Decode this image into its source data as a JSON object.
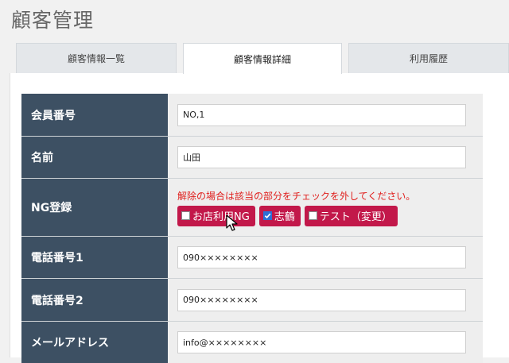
{
  "page": {
    "title": "顧客管理"
  },
  "tabs": [
    {
      "label": "顧客情報一覧",
      "active": false
    },
    {
      "label": "顧客情報詳細",
      "active": true
    },
    {
      "label": "利用履歴",
      "active": false
    }
  ],
  "form": {
    "member_no": {
      "label": "会員番号",
      "value": "NO,1"
    },
    "name": {
      "label": "名前",
      "value": "山田"
    },
    "ng": {
      "label": "NG登録",
      "note": "解除の場合は該当の部分をチェックを外してください。",
      "options": [
        {
          "label": "お店利用NG",
          "checked": false
        },
        {
          "label": "志鶴",
          "checked": true
        },
        {
          "label": "テスト（変更）",
          "checked": false
        }
      ]
    },
    "phone1": {
      "label": "電話番号1",
      "value": "090××××××××"
    },
    "phone2": {
      "label": "電話番号2",
      "value": "090××××××××"
    },
    "email": {
      "label": "メールアドレス",
      "value": "info@××××××××"
    }
  },
  "colors": {
    "header_bg": "#3d5063",
    "ng_button": "#c2184a",
    "note_text": "#e0201e",
    "checkbox_checked": "#2c6fd6"
  }
}
